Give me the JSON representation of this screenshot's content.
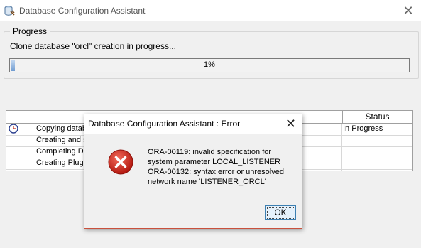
{
  "window": {
    "title": "Database Configuration Assistant"
  },
  "progress": {
    "legend": "Progress",
    "message": "Clone database \"orcl\" creation in progress...",
    "percent_label": "1%",
    "percent_value": 1
  },
  "steps_table": {
    "status_header": "Status",
    "rows": [
      {
        "step": "Copying datab",
        "status": "In Progress",
        "icon": "clock-icon"
      },
      {
        "step": "Creating and s",
        "status": ""
      },
      {
        "step": "Completing Da",
        "status": ""
      },
      {
        "step": "Creating Plugg",
        "status": ""
      }
    ]
  },
  "error_dialog": {
    "title": "Database Configuration Assistant : Error",
    "icon": "error-x-icon",
    "message_lines": [
      "ORA-00119: invalid specification for",
      "system parameter LOCAL_LISTENER",
      "ORA-00132: syntax error or unresolved",
      "network name 'LISTENER_ORCL'"
    ],
    "ok_label": "OK"
  },
  "colors": {
    "error_red": "#d32f2f",
    "dialog_border": "#c9503c",
    "progress_blue": "#6f9bd0"
  }
}
